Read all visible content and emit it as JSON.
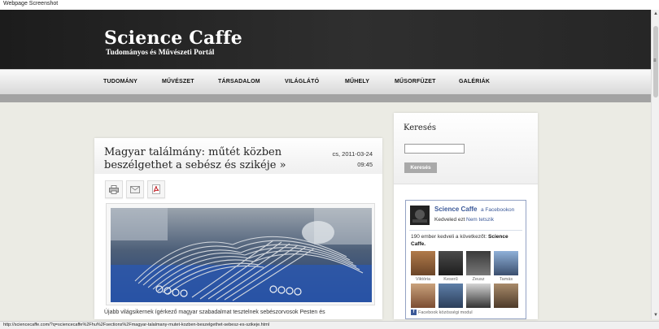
{
  "window": {
    "caption": "Webpage Screenshot"
  },
  "header": {
    "title": "Science Caffe",
    "subtitle": "Tudományos és Művészeti Portál"
  },
  "nav": {
    "items": [
      {
        "label": "TUDOMÁNY"
      },
      {
        "label": "MŰVÉSZET"
      },
      {
        "label": "TÁRSADALOM"
      },
      {
        "label": "VILÁGLÁTÓ"
      },
      {
        "label": "MŰHELY"
      },
      {
        "label": "MŰSORFÜZET"
      },
      {
        "label": "GALÉRIÁK"
      }
    ]
  },
  "article": {
    "title": "Magyar találmány: műtét közben beszélgethet a sebész és szikéje »",
    "date": "cs, 2011-03-24",
    "time": "09:45",
    "tools": [
      {
        "icon": "printer-icon"
      },
      {
        "icon": "email-icon"
      },
      {
        "icon": "pdf-icon"
      }
    ],
    "teaser": "Újabb világsikernek ígérkező magyar szabadalmat tesztelnek sebészorvosok Pesten és"
  },
  "sidebar": {
    "search": {
      "heading": "Keresés",
      "input_value": "",
      "button_label": "Keresés"
    },
    "facebook": {
      "page_name": "Science Caffe",
      "suffix": "a Facebookon",
      "liked_text": "Kedveled ezt",
      "unlike_label": "Nem tetszik",
      "count_text": "190 ember kedveli a következőt:",
      "count_bold": "Science Caffe.",
      "fans": [
        {
          "name": "Viktória"
        },
        {
          "name": "Keserű"
        },
        {
          "name": "Zeusz"
        },
        {
          "name": "Tamás"
        },
        {
          "name": ""
        },
        {
          "name": ""
        },
        {
          "name": ""
        },
        {
          "name": ""
        }
      ],
      "footer": "Facebook közösségi modul"
    }
  },
  "status_bar": {
    "url": "http://sciencecaffe.com/?q=sciencecaffe%2Fhu%2Fsections%2Fmagyar-talalmany-mutet-kozben-beszelgethet-sebesz-es-szikeje.html"
  },
  "colors": {
    "header_bg": "#262626",
    "facebook_blue": "#3b5998",
    "band": "#a3a3a3",
    "page_bg": "#ebebe4"
  }
}
